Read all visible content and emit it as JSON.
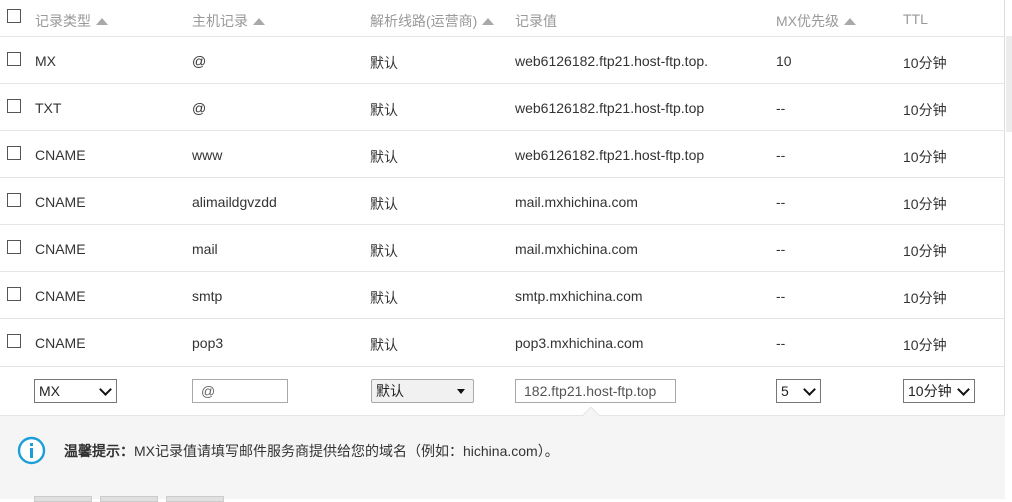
{
  "header": {
    "record_type": "记录类型",
    "host_record": "主机记录",
    "line": "解析线路(运营商)",
    "record_value": "记录值",
    "mx_priority": "MX优先级",
    "ttl": "TTL"
  },
  "rows": [
    {
      "type": "MX",
      "host": "@",
      "line": "默认",
      "value": "web6126182.ftp21.host-ftp.top.",
      "mx": "10",
      "ttl": "10分钟"
    },
    {
      "type": "TXT",
      "host": "@",
      "line": "默认",
      "value": "web6126182.ftp21.host-ftp.top",
      "mx": "--",
      "ttl": "10分钟"
    },
    {
      "type": "CNAME",
      "host": "www",
      "line": "默认",
      "value": "web6126182.ftp21.host-ftp.top",
      "mx": "--",
      "ttl": "10分钟"
    },
    {
      "type": "CNAME",
      "host": "alimaildgvzdd",
      "line": "默认",
      "value": "mail.mxhichina.com",
      "mx": "--",
      "ttl": "10分钟"
    },
    {
      "type": "CNAME",
      "host": "mail",
      "line": "默认",
      "value": "mail.mxhichina.com",
      "mx": "--",
      "ttl": "10分钟"
    },
    {
      "type": "CNAME",
      "host": "smtp",
      "line": "默认",
      "value": "smtp.mxhichina.com",
      "mx": "--",
      "ttl": "10分钟"
    },
    {
      "type": "CNAME",
      "host": "pop3",
      "line": "默认",
      "value": "pop3.mxhichina.com",
      "mx": "--",
      "ttl": "10分钟"
    }
  ],
  "edit": {
    "type_selected": "MX",
    "host_placeholder": "@",
    "line_selected": "默认",
    "value_text": "182.ftp21.host-ftp.top",
    "mx_selected": "5",
    "ttl_selected": "10分钟"
  },
  "tip": {
    "label": "温馨提示：",
    "text": "MX记录值请填写邮件服务商提供给您的域名（例如：hichina.com）。"
  },
  "colors": {
    "accent": "#1a9fd8",
    "divider": "#e5e5e5",
    "tip_background": "#f5f5f5"
  }
}
